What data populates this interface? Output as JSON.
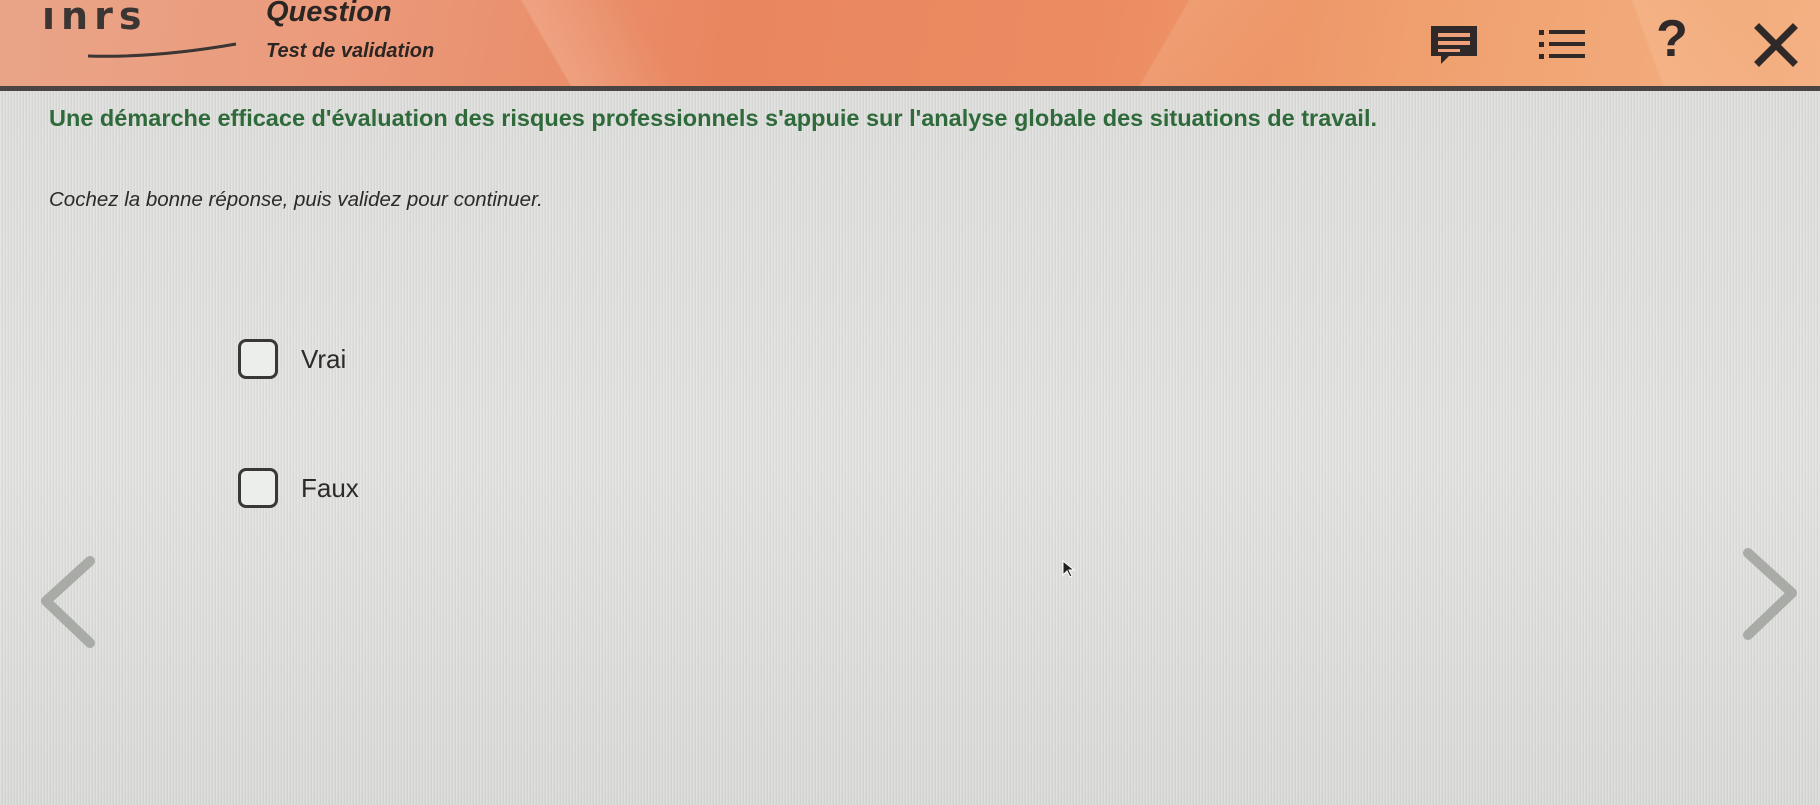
{
  "header": {
    "logo_text": "ınrs",
    "title": "Question",
    "subtitle": "Test de validation",
    "icons": [
      "transcript-icon",
      "menu-list-icon",
      "help-icon",
      "close-icon"
    ],
    "help_glyph": "?",
    "close_glyph": "✕"
  },
  "main": {
    "question": "Une démarche efficace d'évaluation des risques professionnels s'appuie sur l'analyse globale des situations de travail.",
    "instruction": "Cochez la bonne réponse, puis validez pour continuer.",
    "options": [
      {
        "label": "Vrai",
        "checked": false
      },
      {
        "label": "Faux",
        "checked": false
      }
    ]
  },
  "navigation": {
    "previous_icon": "chevron-left-icon",
    "next_icon": "chevron-right-icon"
  },
  "colors": {
    "question_green": "#2f6a3a",
    "header_orange": "#e98660",
    "header_rule": "#4a4443"
  }
}
